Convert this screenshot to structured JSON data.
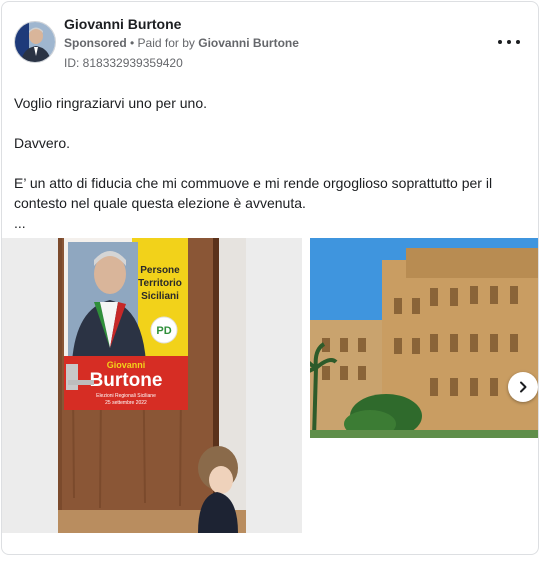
{
  "post": {
    "author_name": "Giovanni Burtone",
    "sponsored_label": "Sponsored",
    "paid_for_prefix": " • Paid for by ",
    "payer": "Giovanni Burtone",
    "ad_id": "ID: 818332939359420",
    "text_lines": [
      "Voglio ringraziarvi uno per uno.",
      "Davvero.",
      "E’ un atto di fiducia che mi commuove e mi rende orgoglioso soprattutto per il contesto nel quale questa elezione è avvenuta.",
      "..."
    ]
  },
  "poster": {
    "side_lines": [
      "Persone",
      "Territorio",
      "Siciliani"
    ],
    "logo": "PD",
    "first_name": "Giovanni",
    "last_name": "Burtone",
    "subtitle": "Elezioni Regionali Siciliane",
    "date": "25 settembre 2022"
  },
  "icons": {
    "more": "more-horizontal-icon",
    "next": "chevron-right-icon"
  },
  "colors": {
    "poster_yellow": "#f2d21a",
    "poster_red": "#d62d24",
    "sky": "#3f95de"
  }
}
